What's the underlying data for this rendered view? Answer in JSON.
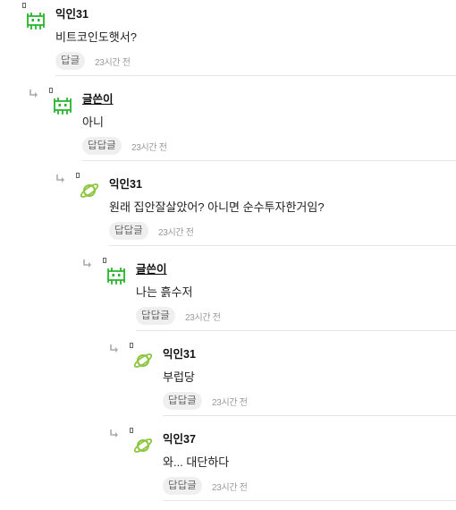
{
  "comments": [
    {
      "nickname": "익인31",
      "content": "비트코인도햇서?",
      "reply_label": "답글",
      "time": "23시간 전",
      "avatar": "green-invader-icon",
      "is_author": false
    },
    {
      "nickname": "글쓴이",
      "content": "아니",
      "reply_label": "답답글",
      "time": "23시간 전",
      "avatar": "green-invader-icon",
      "is_author": true
    },
    {
      "nickname": "익인31",
      "content": "원래 집안잘살았어? 아니면 순수투자한거임?",
      "reply_label": "답답글",
      "time": "23시간 전",
      "avatar": "lime-planet-icon",
      "is_author": false
    },
    {
      "nickname": "글쓴이",
      "content": "나는 흙수저",
      "reply_label": "답답글",
      "time": "23시간 전",
      "avatar": "green-invader-icon",
      "is_author": true
    },
    {
      "nickname": "익인31",
      "content": "부럽당",
      "reply_label": "답답글",
      "time": "23시간 전",
      "avatar": "lime-planet-icon",
      "is_author": false
    },
    {
      "nickname": "익인37",
      "content": "와... 대단하다",
      "reply_label": "답답글",
      "time": "23시간 전",
      "avatar": "lime-planet-icon",
      "is_author": false
    }
  ],
  "colors": {
    "invader_green": "#27b52a",
    "planet_lime": "#8cc63f",
    "button_bg": "#efefef",
    "divider": "#e6e6e6"
  }
}
